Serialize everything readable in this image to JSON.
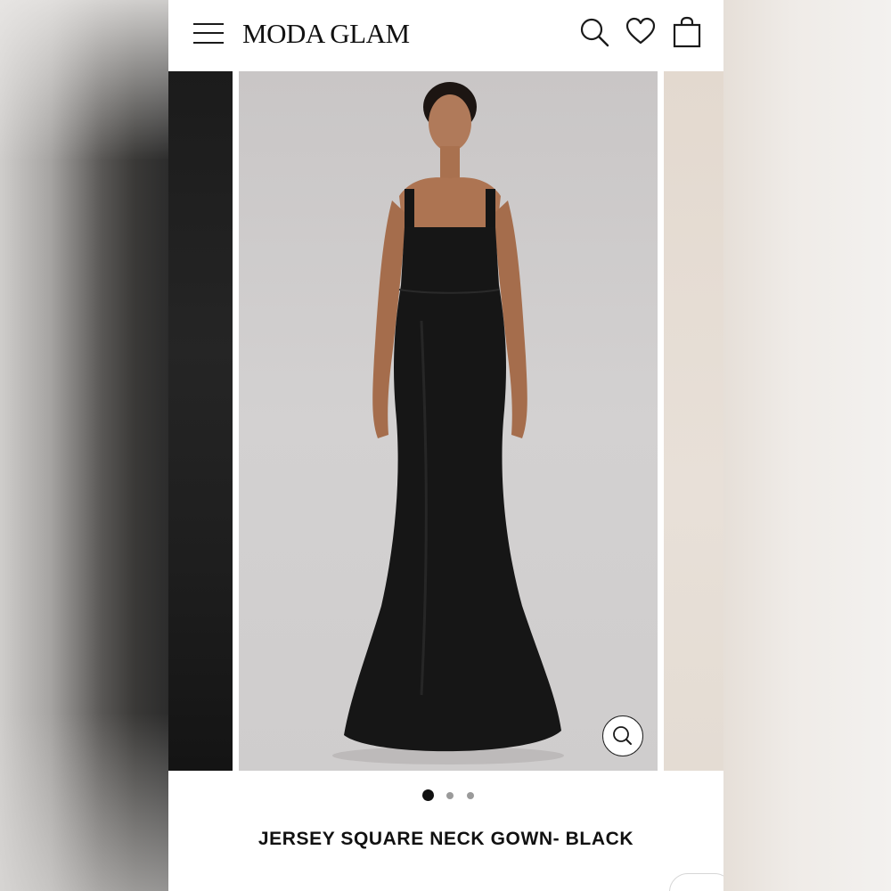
{
  "header": {
    "logo": "MODA GLAM",
    "icons": [
      "menu-icon",
      "search-icon",
      "heart-icon",
      "shopping-bag-icon"
    ]
  },
  "gallery": {
    "current_slide": 1,
    "total_slides": 3,
    "zoom_icon": "magnifier-icon"
  },
  "product": {
    "title": "JERSEY SQUARE NECK GOWN- BLACK"
  },
  "colors": {
    "text": "#111111",
    "background": "#ffffff",
    "dot_active": "#111111",
    "dot_inactive": "#9a9a9a"
  }
}
